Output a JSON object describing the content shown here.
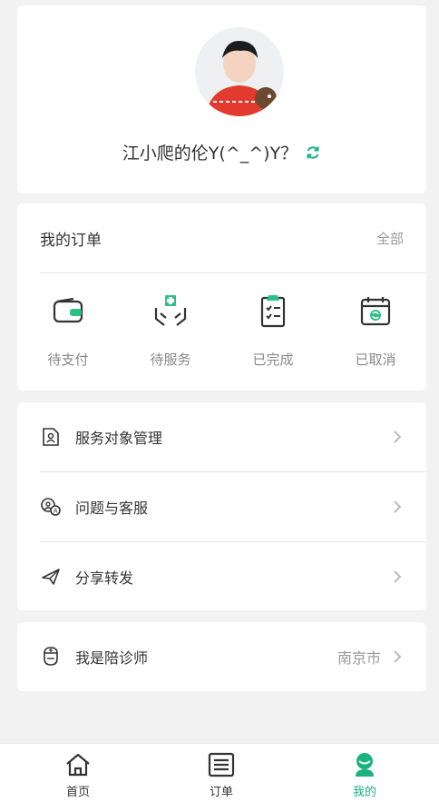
{
  "profile": {
    "name": "江小爬的伦Y(^_^)Y？"
  },
  "orders": {
    "title": "我的订单",
    "all_label": "全部",
    "items": [
      {
        "label": "待支付",
        "icon": "wallet-icon"
      },
      {
        "label": "待服务",
        "icon": "medical-hands-icon"
      },
      {
        "label": "已完成",
        "icon": "clipboard-check-icon"
      },
      {
        "label": "已取消",
        "icon": "calendar-cancel-icon"
      }
    ]
  },
  "menu": {
    "items": [
      {
        "label": "服务对象管理",
        "icon": "person-document-icon"
      },
      {
        "label": "问题与客服",
        "icon": "customer-service-icon"
      },
      {
        "label": "分享转发",
        "icon": "send-icon"
      }
    ]
  },
  "doctor": {
    "label": "我是陪诊师",
    "city": "南京市",
    "icon": "doctor-icon"
  },
  "tabbar": {
    "tabs": [
      {
        "label": "首页",
        "icon": "home-icon"
      },
      {
        "label": "订单",
        "icon": "list-icon"
      },
      {
        "label": "我的",
        "icon": "profile-icon",
        "active": true
      }
    ]
  },
  "colors": {
    "accent": "#19b17c",
    "background": "#f2f2f2"
  }
}
